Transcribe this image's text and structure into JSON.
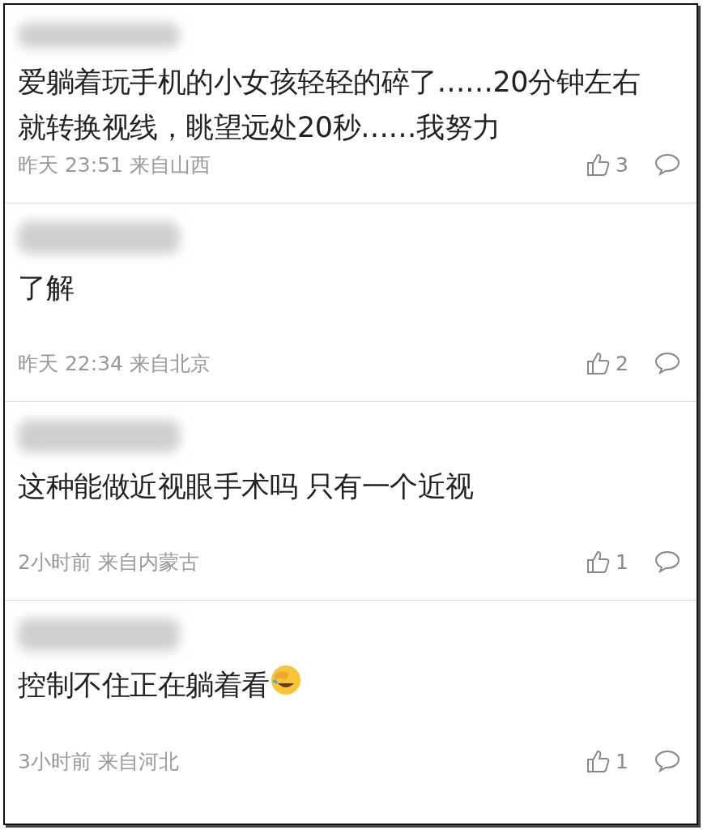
{
  "comments": [
    {
      "text": "爱躺着玩手机的小女孩轻轻的碎了……20分钟左右就转换视线，眺望远处20秒……我努力",
      "meta": "昨天 23:51 来自山西",
      "likes": "3",
      "emoji": false
    },
    {
      "text": "了解",
      "meta": "昨天 22:34 来自北京",
      "likes": "2",
      "emoji": false
    },
    {
      "text": "这种能做近视眼手术吗 只有一个近视",
      "meta": "2小时前 来自内蒙古",
      "likes": "1",
      "emoji": false
    },
    {
      "text": "控制不住正在躺着看",
      "meta": "3小时前 来自河北",
      "likes": "1",
      "emoji": true
    }
  ]
}
